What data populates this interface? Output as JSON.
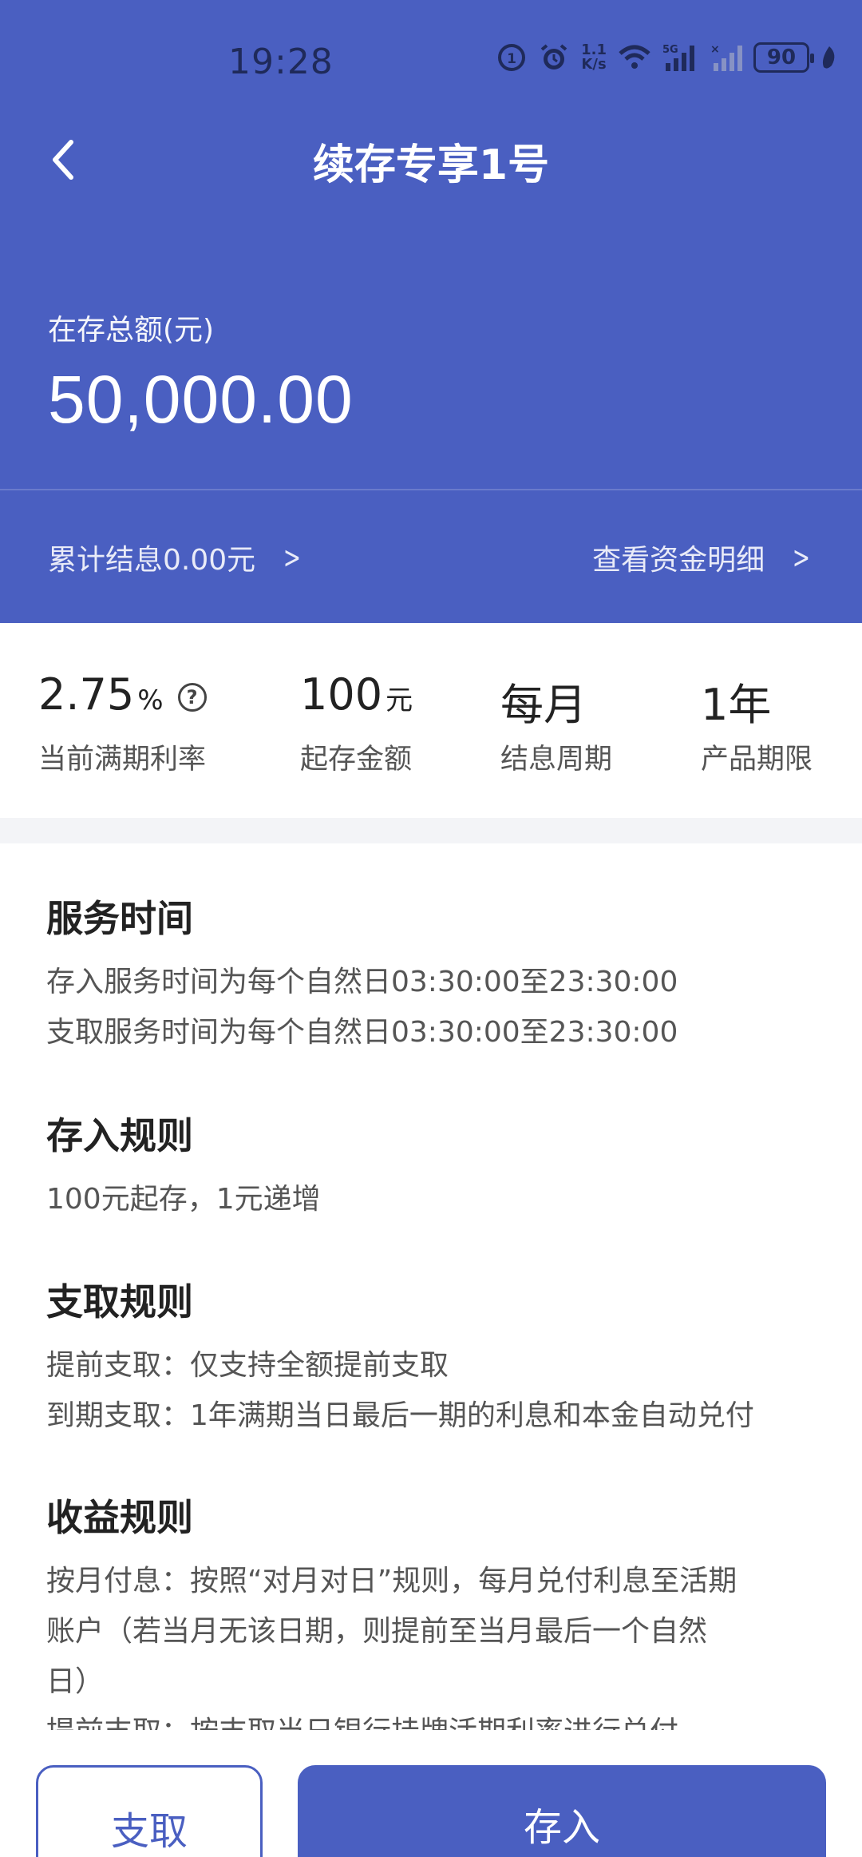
{
  "status_bar": {
    "time": "19:28",
    "network_speed_value": "1.1",
    "network_speed_unit": "K/s",
    "battery": "90",
    "icons": [
      "data-saver-icon",
      "alarm-icon",
      "wifi-icon",
      "5g-signal-icon",
      "signal-no-service-icon",
      "battery-icon",
      "leaf-icon"
    ]
  },
  "nav": {
    "title": "续存专享1号",
    "back_icon": "chevron-left-icon"
  },
  "summary": {
    "total_label": "在存总额(元)",
    "total_amount": "50,000.00",
    "accrued_interest": "累计结息0.00元",
    "view_details": "查看资金明细"
  },
  "stats": [
    {
      "value": "2.75",
      "unit": "%",
      "label": "当前满期利率"
    },
    {
      "value": "100",
      "unit": "元",
      "label": "起存金额"
    },
    {
      "value": "每月",
      "unit": "",
      "label": "结息周期"
    },
    {
      "value": "1年",
      "unit": "",
      "label": "产品期限"
    }
  ],
  "sections": {
    "service_time": {
      "title": "服务时间",
      "lines": [
        "存入服务时间为每个自然日03:30:00至23:30:00",
        "支取服务时间为每个自然日03:30:00至23:30:00"
      ]
    },
    "deposit_rules": {
      "title": "存入规则",
      "lines": [
        "100元起存，1元递增"
      ]
    },
    "withdraw_rules": {
      "title": "支取规则",
      "lines": [
        "提前支取：仅支持全额提前支取",
        "到期支取：1年满期当日最后一期的利息和本金自动兑付"
      ]
    },
    "income_rules": {
      "title": "收益规则",
      "lines": [
        "按月付息：按照“对月对日”规则，每月兑付利息至活期",
        "账户（若当月无该日期，则提前至当月最后一个自然",
        "日）",
        "提前支取：按支取当日银行挂牌活期利率进行兑付"
      ]
    }
  },
  "buttons": {
    "withdraw": "支取",
    "deposit": "存入"
  },
  "colors": {
    "primary": "#4a5fc1",
    "status_icons": "#1f2a5a",
    "page_bg": "#ffffff",
    "gap_bg": "#f3f4f7"
  }
}
